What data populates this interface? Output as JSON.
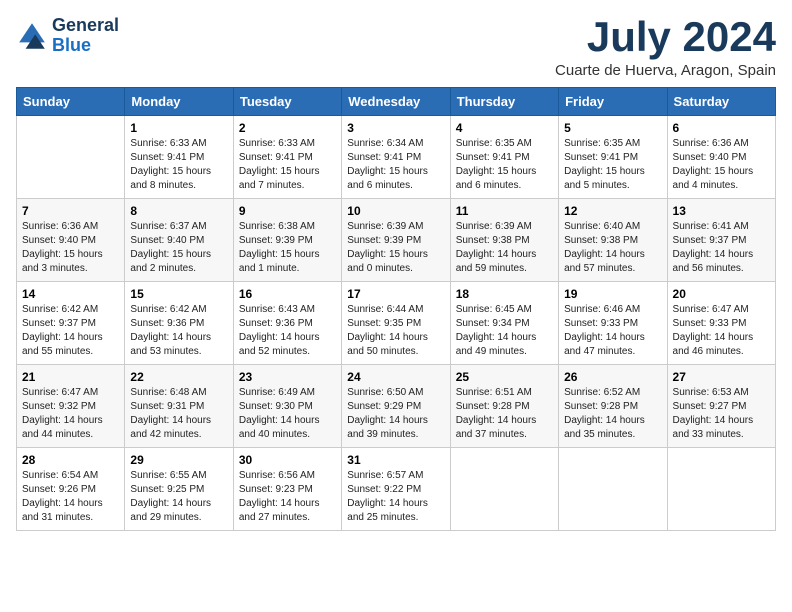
{
  "header": {
    "logo_line1": "General",
    "logo_line2": "Blue",
    "month_title": "July 2024",
    "subtitle": "Cuarte de Huerva, Aragon, Spain"
  },
  "days_of_week": [
    "Sunday",
    "Monday",
    "Tuesday",
    "Wednesday",
    "Thursday",
    "Friday",
    "Saturday"
  ],
  "weeks": [
    [
      {
        "day": "",
        "info": ""
      },
      {
        "day": "1",
        "info": "Sunrise: 6:33 AM\nSunset: 9:41 PM\nDaylight: 15 hours\nand 8 minutes."
      },
      {
        "day": "2",
        "info": "Sunrise: 6:33 AM\nSunset: 9:41 PM\nDaylight: 15 hours\nand 7 minutes."
      },
      {
        "day": "3",
        "info": "Sunrise: 6:34 AM\nSunset: 9:41 PM\nDaylight: 15 hours\nand 6 minutes."
      },
      {
        "day": "4",
        "info": "Sunrise: 6:35 AM\nSunset: 9:41 PM\nDaylight: 15 hours\nand 6 minutes."
      },
      {
        "day": "5",
        "info": "Sunrise: 6:35 AM\nSunset: 9:41 PM\nDaylight: 15 hours\nand 5 minutes."
      },
      {
        "day": "6",
        "info": "Sunrise: 6:36 AM\nSunset: 9:40 PM\nDaylight: 15 hours\nand 4 minutes."
      }
    ],
    [
      {
        "day": "7",
        "info": "Sunrise: 6:36 AM\nSunset: 9:40 PM\nDaylight: 15 hours\nand 3 minutes."
      },
      {
        "day": "8",
        "info": "Sunrise: 6:37 AM\nSunset: 9:40 PM\nDaylight: 15 hours\nand 2 minutes."
      },
      {
        "day": "9",
        "info": "Sunrise: 6:38 AM\nSunset: 9:39 PM\nDaylight: 15 hours\nand 1 minute."
      },
      {
        "day": "10",
        "info": "Sunrise: 6:39 AM\nSunset: 9:39 PM\nDaylight: 15 hours\nand 0 minutes."
      },
      {
        "day": "11",
        "info": "Sunrise: 6:39 AM\nSunset: 9:38 PM\nDaylight: 14 hours\nand 59 minutes."
      },
      {
        "day": "12",
        "info": "Sunrise: 6:40 AM\nSunset: 9:38 PM\nDaylight: 14 hours\nand 57 minutes."
      },
      {
        "day": "13",
        "info": "Sunrise: 6:41 AM\nSunset: 9:37 PM\nDaylight: 14 hours\nand 56 minutes."
      }
    ],
    [
      {
        "day": "14",
        "info": "Sunrise: 6:42 AM\nSunset: 9:37 PM\nDaylight: 14 hours\nand 55 minutes."
      },
      {
        "day": "15",
        "info": "Sunrise: 6:42 AM\nSunset: 9:36 PM\nDaylight: 14 hours\nand 53 minutes."
      },
      {
        "day": "16",
        "info": "Sunrise: 6:43 AM\nSunset: 9:36 PM\nDaylight: 14 hours\nand 52 minutes."
      },
      {
        "day": "17",
        "info": "Sunrise: 6:44 AM\nSunset: 9:35 PM\nDaylight: 14 hours\nand 50 minutes."
      },
      {
        "day": "18",
        "info": "Sunrise: 6:45 AM\nSunset: 9:34 PM\nDaylight: 14 hours\nand 49 minutes."
      },
      {
        "day": "19",
        "info": "Sunrise: 6:46 AM\nSunset: 9:33 PM\nDaylight: 14 hours\nand 47 minutes."
      },
      {
        "day": "20",
        "info": "Sunrise: 6:47 AM\nSunset: 9:33 PM\nDaylight: 14 hours\nand 46 minutes."
      }
    ],
    [
      {
        "day": "21",
        "info": "Sunrise: 6:47 AM\nSunset: 9:32 PM\nDaylight: 14 hours\nand 44 minutes."
      },
      {
        "day": "22",
        "info": "Sunrise: 6:48 AM\nSunset: 9:31 PM\nDaylight: 14 hours\nand 42 minutes."
      },
      {
        "day": "23",
        "info": "Sunrise: 6:49 AM\nSunset: 9:30 PM\nDaylight: 14 hours\nand 40 minutes."
      },
      {
        "day": "24",
        "info": "Sunrise: 6:50 AM\nSunset: 9:29 PM\nDaylight: 14 hours\nand 39 minutes."
      },
      {
        "day": "25",
        "info": "Sunrise: 6:51 AM\nSunset: 9:28 PM\nDaylight: 14 hours\nand 37 minutes."
      },
      {
        "day": "26",
        "info": "Sunrise: 6:52 AM\nSunset: 9:28 PM\nDaylight: 14 hours\nand 35 minutes."
      },
      {
        "day": "27",
        "info": "Sunrise: 6:53 AM\nSunset: 9:27 PM\nDaylight: 14 hours\nand 33 minutes."
      }
    ],
    [
      {
        "day": "28",
        "info": "Sunrise: 6:54 AM\nSunset: 9:26 PM\nDaylight: 14 hours\nand 31 minutes."
      },
      {
        "day": "29",
        "info": "Sunrise: 6:55 AM\nSunset: 9:25 PM\nDaylight: 14 hours\nand 29 minutes."
      },
      {
        "day": "30",
        "info": "Sunrise: 6:56 AM\nSunset: 9:23 PM\nDaylight: 14 hours\nand 27 minutes."
      },
      {
        "day": "31",
        "info": "Sunrise: 6:57 AM\nSunset: 9:22 PM\nDaylight: 14 hours\nand 25 minutes."
      },
      {
        "day": "",
        "info": ""
      },
      {
        "day": "",
        "info": ""
      },
      {
        "day": "",
        "info": ""
      }
    ]
  ]
}
